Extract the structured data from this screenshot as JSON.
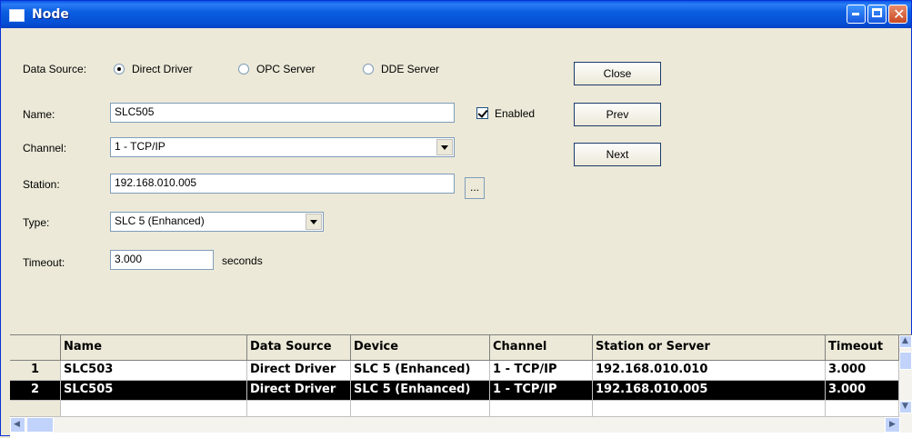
{
  "window": {
    "title": "Node"
  },
  "form": {
    "data_source_label": "Data Source:",
    "data_source_options": [
      "Direct Driver",
      "OPC Server",
      "DDE Server"
    ],
    "data_source_selected": "Direct Driver",
    "name_label": "Name:",
    "name_value": "SLC505",
    "enabled_label": "Enabled",
    "enabled_checked": true,
    "channel_label": "Channel:",
    "channel_value": "1 - TCP/IP",
    "station_label": "Station:",
    "station_value": "192.168.010.005",
    "ellipsis_label": "...",
    "type_label": "Type:",
    "type_value": "SLC 5 (Enhanced)",
    "timeout_label": "Timeout:",
    "timeout_value": "3.000",
    "timeout_units": "seconds"
  },
  "buttons": {
    "close": "Close",
    "prev": "Prev",
    "next": "Next"
  },
  "grid": {
    "columns": [
      "Name",
      "Data Source",
      "Device",
      "Channel",
      "Station or Server",
      "Timeout"
    ],
    "rows": [
      {
        "num": "1",
        "cells": [
          "SLC503",
          "Direct Driver",
          "SLC 5 (Enhanced)",
          "1 - TCP/IP",
          "192.168.010.010",
          "3.000"
        ],
        "selected": false
      },
      {
        "num": "2",
        "cells": [
          "SLC505",
          "Direct Driver",
          "SLC 5 (Enhanced)",
          "1 - TCP/IP",
          "192.168.010.005",
          "3.000"
        ],
        "selected": true
      }
    ]
  }
}
